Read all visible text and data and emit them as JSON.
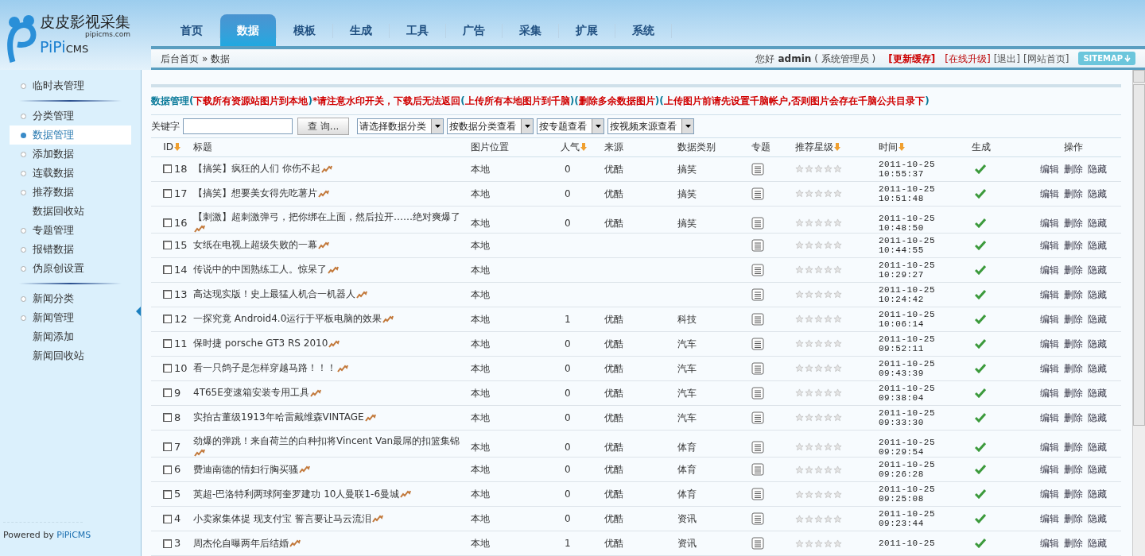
{
  "logo": {
    "title": "皮皮影视采集",
    "domain": "pipicms.com",
    "brand_a": "PiPi",
    "brand_b": "CMS"
  },
  "nav": [
    {
      "label": "首页",
      "selected": false
    },
    {
      "label": "数据",
      "selected": true
    },
    {
      "label": "模板",
      "selected": false
    },
    {
      "label": "生成",
      "selected": false
    },
    {
      "label": "工具",
      "selected": false
    },
    {
      "label": "广告",
      "selected": false
    },
    {
      "label": "采集",
      "selected": false
    },
    {
      "label": "扩展",
      "selected": false
    },
    {
      "label": "系统",
      "selected": false
    }
  ],
  "breadcrumb": {
    "home": "后台首页",
    "sep": "»",
    "current": "数据"
  },
  "user_bar": {
    "greeting": "您好",
    "user": "admin",
    "role": "( 系统管理员 )",
    "links": [
      {
        "label": "[更新缓存]",
        "kind": "strong"
      },
      {
        "label": "[在线升级]",
        "kind": "warn"
      },
      {
        "label": "[退出]",
        "kind": "plain"
      },
      {
        "label": "[网站首页]",
        "kind": "plain"
      }
    ],
    "sitemap": "SITEMAP"
  },
  "sidebar": {
    "groups": [
      [
        {
          "label": "临时表管理",
          "kind": "bullet",
          "selected": false
        }
      ],
      [
        {
          "label": "分类管理",
          "kind": "bullet",
          "selected": false
        },
        {
          "label": "数据管理",
          "kind": "bullet",
          "selected": true
        },
        {
          "label": "添加数据",
          "kind": "bullet",
          "selected": false
        },
        {
          "label": "连载数据",
          "kind": "bullet",
          "selected": false
        },
        {
          "label": "推荐数据",
          "kind": "bullet",
          "selected": false
        },
        {
          "label": "数据回收站",
          "kind": "plain",
          "selected": false
        },
        {
          "label": "专题管理",
          "kind": "bullet",
          "selected": false
        },
        {
          "label": "报错数据",
          "kind": "bullet",
          "selected": false
        },
        {
          "label": "伪原创设置",
          "kind": "bullet",
          "selected": false
        }
      ],
      [
        {
          "label": "新闻分类",
          "kind": "bullet",
          "selected": false
        },
        {
          "label": "新闻管理",
          "kind": "bullet",
          "selected": false
        },
        {
          "label": "新闻添加",
          "kind": "plain",
          "selected": false
        },
        {
          "label": "新闻回收站",
          "kind": "plain",
          "selected": false
        }
      ]
    ],
    "footer_text": "Powered by ",
    "footer_link": "PiPiCMS"
  },
  "notice": [
    {
      "text": "数据管理(",
      "kind": "text"
    },
    {
      "text": "下载所有资源站图片到本地",
      "kind": "link"
    },
    {
      "text": ")",
      "kind": "text"
    },
    {
      "text": "*请注意水印开关，下载后无法返回",
      "kind": "link"
    },
    {
      "text": "(",
      "kind": "text"
    },
    {
      "text": "上传所有本地图片到千脑",
      "kind": "link"
    },
    {
      "text": ")(",
      "kind": "text"
    },
    {
      "text": "删除多余数据图片",
      "kind": "link"
    },
    {
      "text": ")(",
      "kind": "text"
    },
    {
      "text": "上传图片前请先设置千脑帐户,否则图片会存在千脑公共目录下",
      "kind": "link"
    },
    {
      "text": ")",
      "kind": "text"
    }
  ],
  "filters": {
    "keyword_label": "关键字",
    "search_button": "查 询...",
    "selects": [
      "请选择数据分类",
      "按数据分类查看",
      "按专题查看",
      "按视频来源查看"
    ]
  },
  "table": {
    "columns": [
      {
        "label": "ID",
        "sortable": true
      },
      {
        "label": "标题",
        "sortable": false
      },
      {
        "label": "图片位置",
        "sortable": false
      },
      {
        "label": "人气",
        "sortable": true
      },
      {
        "label": "来源",
        "sortable": false
      },
      {
        "label": "数据类别",
        "sortable": false
      },
      {
        "label": "专题",
        "sortable": false
      },
      {
        "label": "推荐星级",
        "sortable": true
      },
      {
        "label": "时间",
        "sortable": true
      },
      {
        "label": "生成",
        "sortable": false
      },
      {
        "label": "操作",
        "sortable": false
      }
    ],
    "rows": [
      {
        "checked": false,
        "id": "18",
        "title": "【搞笑】疯狂的人们 你伤不起",
        "image": "本地",
        "hits": "0",
        "source": "优酷",
        "category": "搞笑",
        "stars": 0,
        "date": "2011-10-25",
        "time": "10:55:37",
        "generated": true,
        "actions": [
          "编辑",
          "删除",
          "隐藏"
        ]
      },
      {
        "checked": false,
        "id": "17",
        "title": "【搞笑】想要美女得先吃薯片",
        "image": "本地",
        "hits": "0",
        "source": "优酷",
        "category": "搞笑",
        "stars": 0,
        "date": "2011-10-25",
        "time": "10:51:48",
        "generated": true,
        "actions": [
          "编辑",
          "删除",
          "隐藏"
        ]
      },
      {
        "checked": false,
        "id": "16",
        "title": "【刺激】超刺激弹弓，把你绑在上面，然后拉开……绝对爽爆了",
        "image": "本地",
        "hits": "0",
        "source": "优酷",
        "category": "搞笑",
        "stars": 0,
        "date": "2011-10-25",
        "time": "10:48:50",
        "generated": true,
        "actions": [
          "编辑",
          "删除",
          "隐藏"
        ]
      },
      {
        "checked": false,
        "id": "15",
        "title": "女纸在电视上超级失败的一幕",
        "image": "本地",
        "stars": 0,
        "date": "2011-10-25",
        "time": "10:44:55",
        "generated": true,
        "actions": [
          "编辑",
          "删除",
          "隐藏"
        ]
      },
      {
        "checked": false,
        "id": "14",
        "title": "传说中的中国熟练工人。惊呆了",
        "image": "本地",
        "stars": 0,
        "date": "2011-10-25",
        "time": "10:29:27",
        "generated": true,
        "actions": [
          "编辑",
          "删除",
          "隐藏"
        ]
      },
      {
        "checked": false,
        "id": "13",
        "title": "高达现实版！史上最猛人机合一机器人",
        "image": "本地",
        "stars": 0,
        "date": "2011-10-25",
        "time": "10:24:42",
        "generated": true,
        "actions": [
          "编辑",
          "删除",
          "隐藏"
        ]
      },
      {
        "checked": false,
        "id": "12",
        "title": "一探究竟 Android4.0运行于平板电脑的效果",
        "image": "本地",
        "hits": "1",
        "source": "优酷",
        "category": "科技",
        "stars": 0,
        "date": "2011-10-25",
        "time": "10:06:14",
        "generated": true,
        "actions": [
          "编辑",
          "删除",
          "隐藏"
        ]
      },
      {
        "checked": false,
        "id": "11",
        "title": "保时捷 porsche GT3 RS 2010",
        "image": "本地",
        "hits": "0",
        "source": "优酷",
        "category": "汽车",
        "stars": 0,
        "date": "2011-10-25",
        "time": "09:52:11",
        "generated": true,
        "actions": [
          "编辑",
          "删除",
          "隐藏"
        ]
      },
      {
        "checked": false,
        "id": "10",
        "title": "看一只鸽子是怎样穿越马路！！！",
        "image": "本地",
        "hits": "0",
        "source": "优酷",
        "category": "汽车",
        "stars": 0,
        "date": "2011-10-25",
        "time": "09:43:39",
        "generated": true,
        "actions": [
          "编辑",
          "删除",
          "隐藏"
        ]
      },
      {
        "checked": false,
        "id": "9",
        "title": "4T65E变速箱安装专用工具",
        "image": "本地",
        "hits": "0",
        "source": "优酷",
        "category": "汽车",
        "stars": 0,
        "date": "2011-10-25",
        "time": "09:38:04",
        "generated": true,
        "actions": [
          "编辑",
          "删除",
          "隐藏"
        ]
      },
      {
        "checked": false,
        "id": "8",
        "title": "实拍古董级1913年哈雷戴维森VINTAGE",
        "image": "本地",
        "hits": "0",
        "source": "优酷",
        "category": "汽车",
        "stars": 0,
        "date": "2011-10-25",
        "time": "09:33:30",
        "generated": true,
        "actions": [
          "编辑",
          "删除",
          "隐藏"
        ]
      },
      {
        "checked": false,
        "id": "7",
        "title": "劲爆的弹跳！来自荷兰的白种扣将Vincent Van最屌的扣篮集锦",
        "image": "本地",
        "hits": "0",
        "source": "优酷",
        "category": "体育",
        "stars": 0,
        "date": "2011-10-25",
        "time": "09:29:54",
        "generated": true,
        "actions": [
          "编辑",
          "删除",
          "隐藏"
        ]
      },
      {
        "checked": false,
        "id": "6",
        "title": "费迪南德的情妇行胸买骚",
        "image": "本地",
        "hits": "0",
        "source": "优酷",
        "category": "体育",
        "stars": 0,
        "date": "2011-10-25",
        "time": "09:26:28",
        "generated": true,
        "actions": [
          "编辑",
          "删除",
          "隐藏"
        ]
      },
      {
        "checked": false,
        "id": "5",
        "title": "英超-巴洛特利两球阿奎罗建功 10人曼联1-6曼城",
        "image": "本地",
        "hits": "0",
        "source": "优酷",
        "category": "体育",
        "stars": 0,
        "date": "2011-10-25",
        "time": "09:25:08",
        "generated": true,
        "actions": [
          "编辑",
          "删除",
          "隐藏"
        ]
      },
      {
        "checked": false,
        "id": "4",
        "title": "小卖家集体提 现支付宝 誓言要让马云流泪",
        "image": "本地",
        "hits": "0",
        "source": "优酷",
        "category": "资讯",
        "stars": 0,
        "date": "2011-10-25",
        "time": "09:23:44",
        "generated": true,
        "actions": [
          "编辑",
          "删除",
          "隐藏"
        ]
      },
      {
        "checked": false,
        "id": "3",
        "title": "周杰伦自曝两年后结婚",
        "image": "本地",
        "hits": "1",
        "source": "优酷",
        "category": "资讯",
        "stars": 0,
        "date": "2011-10-25",
        "generated": true,
        "actions": [
          "编辑",
          "删除",
          "隐藏"
        ]
      }
    ]
  }
}
